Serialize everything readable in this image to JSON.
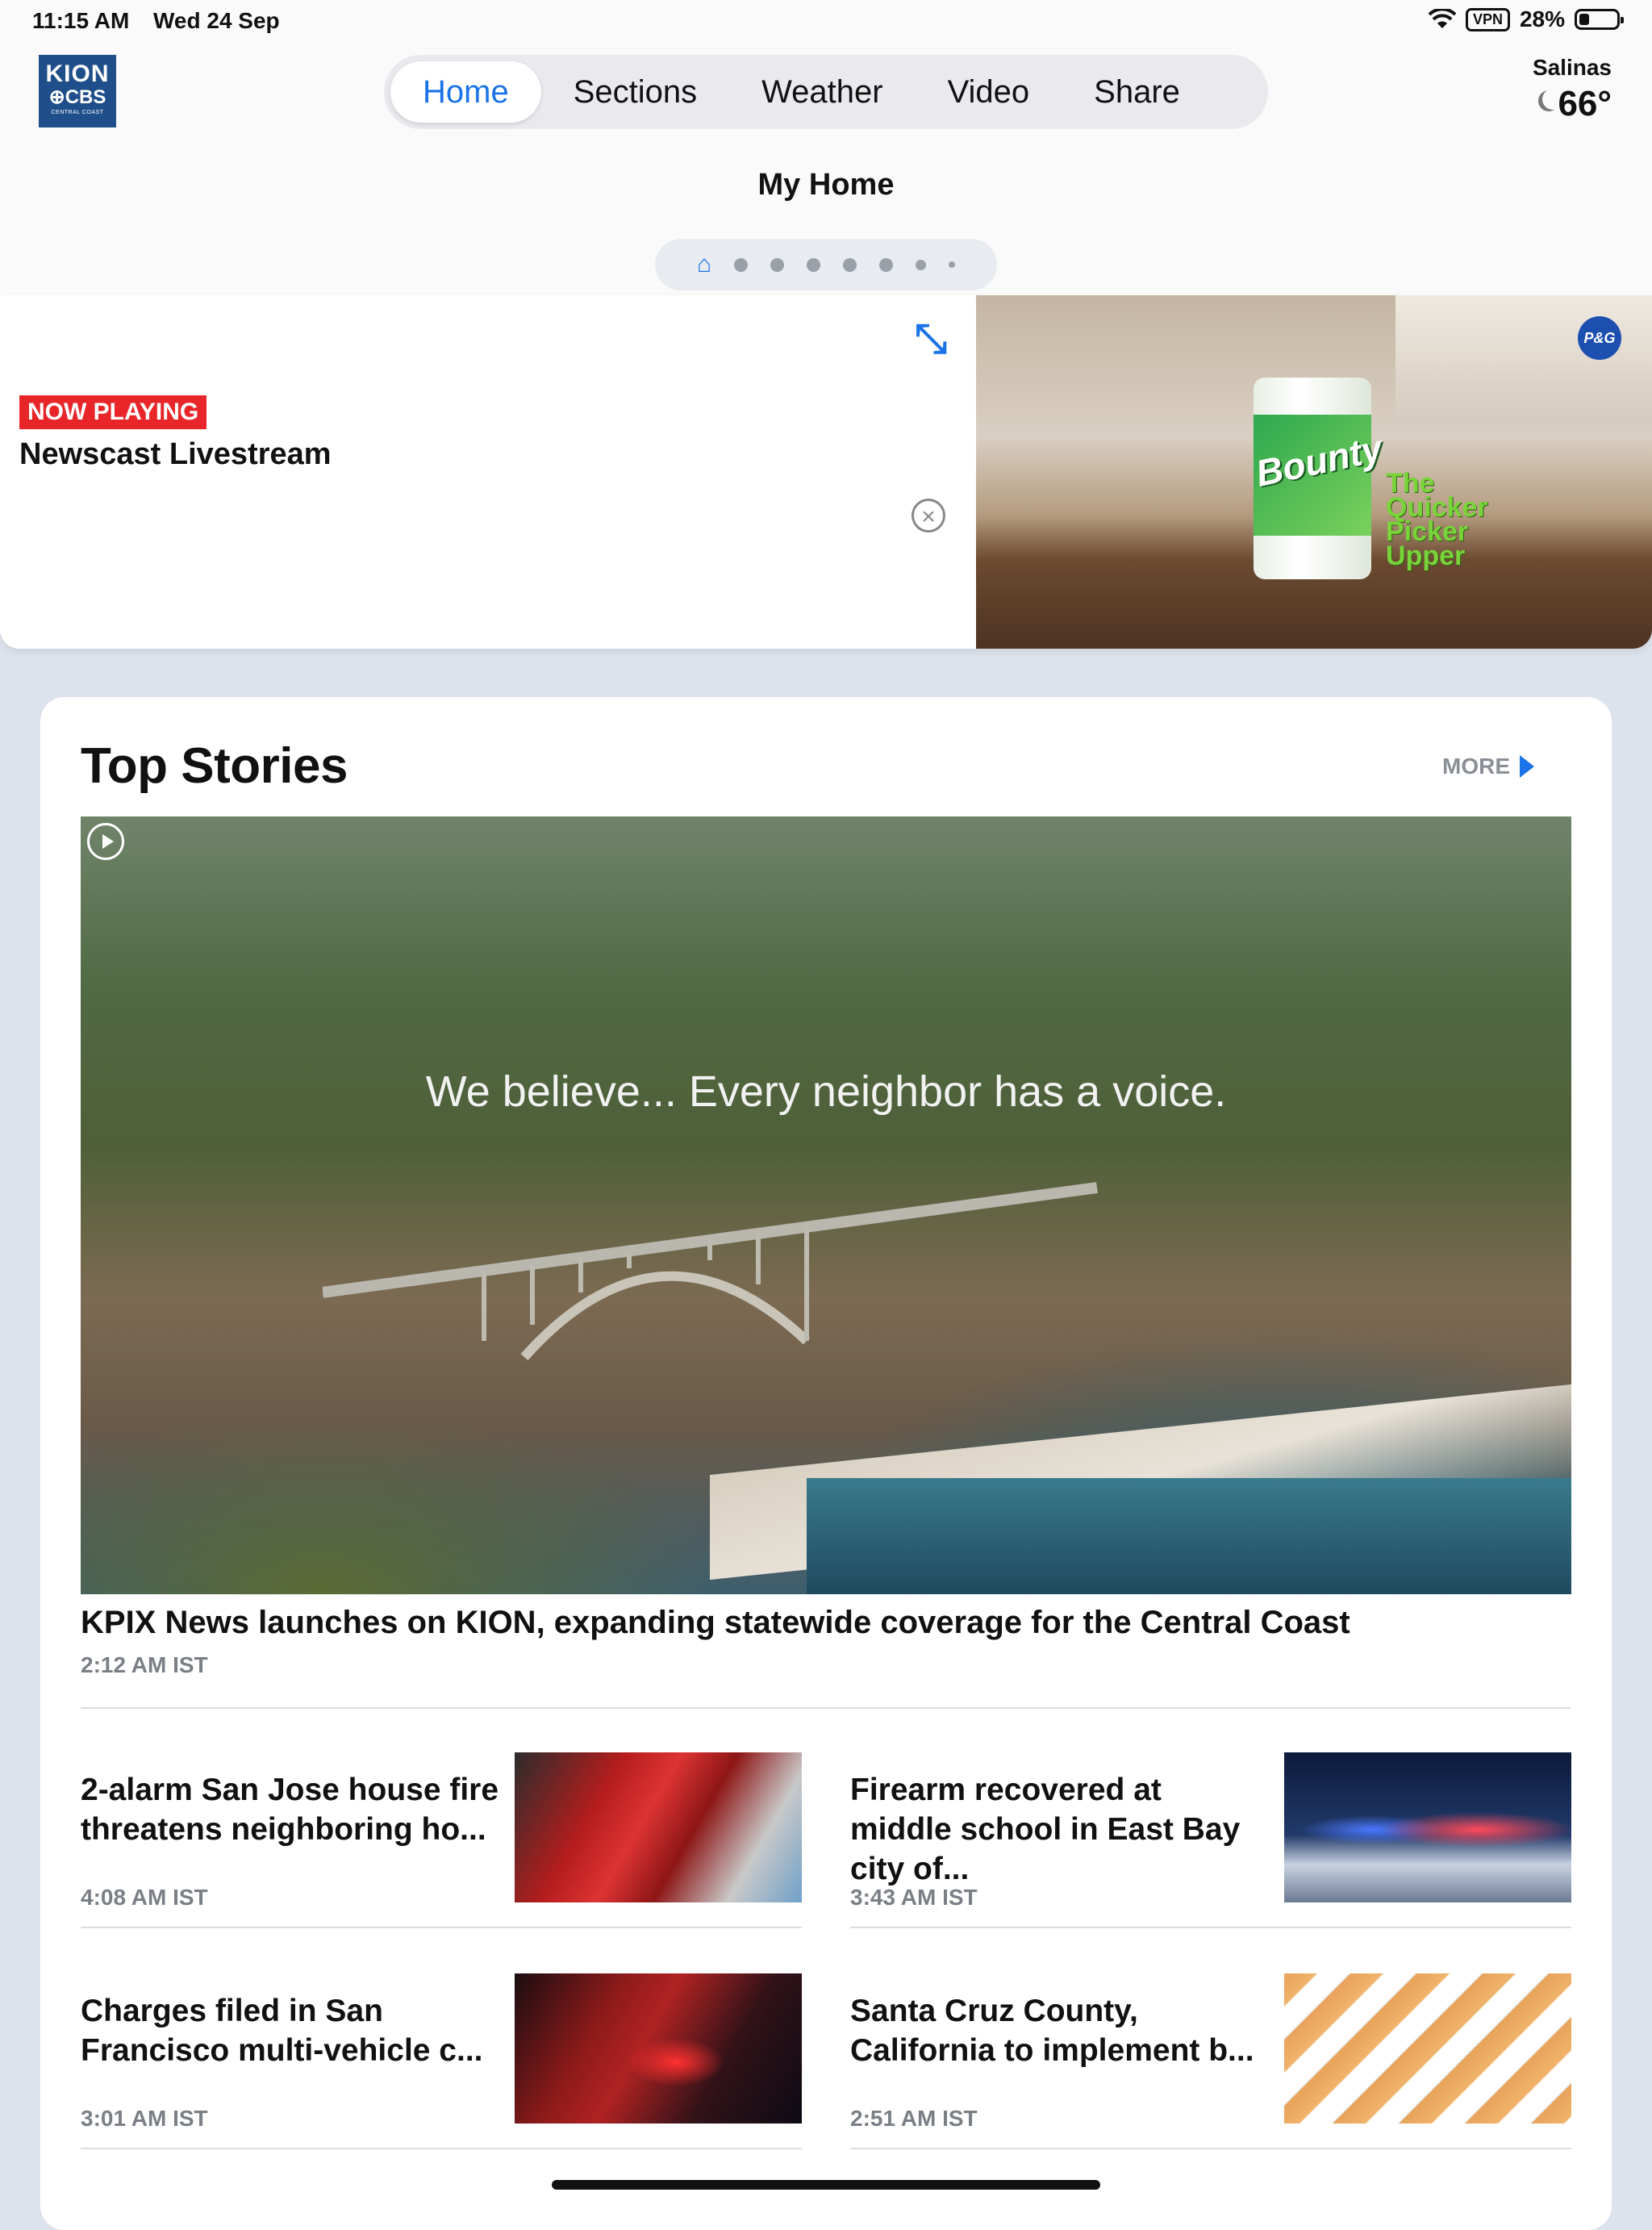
{
  "status_bar": {
    "time": "11:15 AM",
    "date": "Wed 24 Sep",
    "vpn": "VPN",
    "battery": "28%",
    "battery_level": 0.28
  },
  "logo": {
    "line1": "KION",
    "line2": "⊕CBS",
    "line3": "CENTRAL COAST"
  },
  "nav": {
    "tabs": [
      {
        "label": "Home",
        "active": true
      },
      {
        "label": "Sections"
      },
      {
        "label": "Weather"
      },
      {
        "label": "Video"
      },
      {
        "label": "Share"
      }
    ]
  },
  "weather": {
    "city": "Salinas",
    "temp": "66°",
    "icon": "moon-icon"
  },
  "page_title": "My Home",
  "pager": {
    "pages": 7,
    "active": 0
  },
  "player": {
    "badge": "NOW PLAYING",
    "title": "Newscast Livestream",
    "ad": {
      "brand": "Bounty",
      "slogan_line1": "The",
      "slogan_line2": "Quicker",
      "slogan_line3": "Picker",
      "slogan_line4": "Upper",
      "sponsor": "P&G"
    }
  },
  "top_stories": {
    "heading": "Top Stories",
    "more": "MORE",
    "hero": {
      "overlay_text": "We believe... Every neighbor has a voice.",
      "title": "KPIX News launches on KION, expanding statewide coverage for the Central Coast",
      "time": "2:12 AM IST"
    },
    "stories": [
      {
        "title": "2-alarm San Jose house fire threatens neighboring ho...",
        "time": "4:08 AM IST"
      },
      {
        "title": "Firearm recovered at middle school in East Bay city of...",
        "time": "3:43 AM IST"
      },
      {
        "title": "Charges filed in San Francisco multi-vehicle c...",
        "time": "3:01 AM IST"
      },
      {
        "title": "Santa Cruz County, California to implement b...",
        "time": "2:51 AM IST"
      }
    ]
  },
  "colors": {
    "accent": "#1a73e8",
    "badge": "#e8262a",
    "background": "#dde3ec"
  }
}
